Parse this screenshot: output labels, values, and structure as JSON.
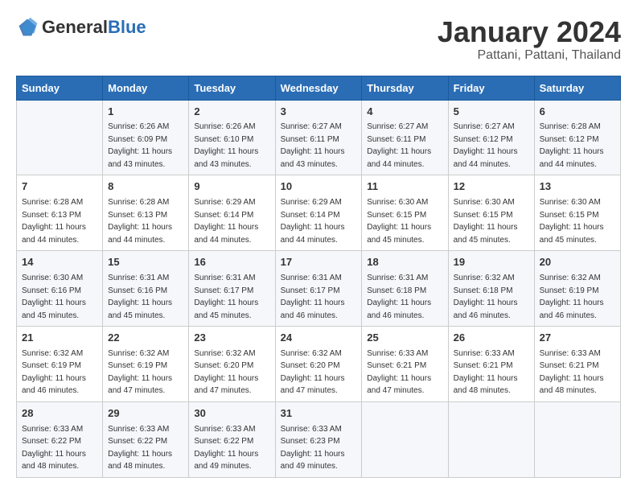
{
  "logo": {
    "general": "General",
    "blue": "Blue"
  },
  "title": "January 2024",
  "location": "Pattani, Pattani, Thailand",
  "days_of_week": [
    "Sunday",
    "Monday",
    "Tuesday",
    "Wednesday",
    "Thursday",
    "Friday",
    "Saturday"
  ],
  "weeks": [
    [
      {
        "num": "",
        "sunrise": "",
        "sunset": "",
        "daylight": ""
      },
      {
        "num": "1",
        "sunrise": "Sunrise: 6:26 AM",
        "sunset": "Sunset: 6:09 PM",
        "daylight": "Daylight: 11 hours and 43 minutes."
      },
      {
        "num": "2",
        "sunrise": "Sunrise: 6:26 AM",
        "sunset": "Sunset: 6:10 PM",
        "daylight": "Daylight: 11 hours and 43 minutes."
      },
      {
        "num": "3",
        "sunrise": "Sunrise: 6:27 AM",
        "sunset": "Sunset: 6:11 PM",
        "daylight": "Daylight: 11 hours and 43 minutes."
      },
      {
        "num": "4",
        "sunrise": "Sunrise: 6:27 AM",
        "sunset": "Sunset: 6:11 PM",
        "daylight": "Daylight: 11 hours and 44 minutes."
      },
      {
        "num": "5",
        "sunrise": "Sunrise: 6:27 AM",
        "sunset": "Sunset: 6:12 PM",
        "daylight": "Daylight: 11 hours and 44 minutes."
      },
      {
        "num": "6",
        "sunrise": "Sunrise: 6:28 AM",
        "sunset": "Sunset: 6:12 PM",
        "daylight": "Daylight: 11 hours and 44 minutes."
      }
    ],
    [
      {
        "num": "7",
        "sunrise": "Sunrise: 6:28 AM",
        "sunset": "Sunset: 6:13 PM",
        "daylight": "Daylight: 11 hours and 44 minutes."
      },
      {
        "num": "8",
        "sunrise": "Sunrise: 6:28 AM",
        "sunset": "Sunset: 6:13 PM",
        "daylight": "Daylight: 11 hours and 44 minutes."
      },
      {
        "num": "9",
        "sunrise": "Sunrise: 6:29 AM",
        "sunset": "Sunset: 6:14 PM",
        "daylight": "Daylight: 11 hours and 44 minutes."
      },
      {
        "num": "10",
        "sunrise": "Sunrise: 6:29 AM",
        "sunset": "Sunset: 6:14 PM",
        "daylight": "Daylight: 11 hours and 44 minutes."
      },
      {
        "num": "11",
        "sunrise": "Sunrise: 6:30 AM",
        "sunset": "Sunset: 6:15 PM",
        "daylight": "Daylight: 11 hours and 45 minutes."
      },
      {
        "num": "12",
        "sunrise": "Sunrise: 6:30 AM",
        "sunset": "Sunset: 6:15 PM",
        "daylight": "Daylight: 11 hours and 45 minutes."
      },
      {
        "num": "13",
        "sunrise": "Sunrise: 6:30 AM",
        "sunset": "Sunset: 6:15 PM",
        "daylight": "Daylight: 11 hours and 45 minutes."
      }
    ],
    [
      {
        "num": "14",
        "sunrise": "Sunrise: 6:30 AM",
        "sunset": "Sunset: 6:16 PM",
        "daylight": "Daylight: 11 hours and 45 minutes."
      },
      {
        "num": "15",
        "sunrise": "Sunrise: 6:31 AM",
        "sunset": "Sunset: 6:16 PM",
        "daylight": "Daylight: 11 hours and 45 minutes."
      },
      {
        "num": "16",
        "sunrise": "Sunrise: 6:31 AM",
        "sunset": "Sunset: 6:17 PM",
        "daylight": "Daylight: 11 hours and 45 minutes."
      },
      {
        "num": "17",
        "sunrise": "Sunrise: 6:31 AM",
        "sunset": "Sunset: 6:17 PM",
        "daylight": "Daylight: 11 hours and 46 minutes."
      },
      {
        "num": "18",
        "sunrise": "Sunrise: 6:31 AM",
        "sunset": "Sunset: 6:18 PM",
        "daylight": "Daylight: 11 hours and 46 minutes."
      },
      {
        "num": "19",
        "sunrise": "Sunrise: 6:32 AM",
        "sunset": "Sunset: 6:18 PM",
        "daylight": "Daylight: 11 hours and 46 minutes."
      },
      {
        "num": "20",
        "sunrise": "Sunrise: 6:32 AM",
        "sunset": "Sunset: 6:19 PM",
        "daylight": "Daylight: 11 hours and 46 minutes."
      }
    ],
    [
      {
        "num": "21",
        "sunrise": "Sunrise: 6:32 AM",
        "sunset": "Sunset: 6:19 PM",
        "daylight": "Daylight: 11 hours and 46 minutes."
      },
      {
        "num": "22",
        "sunrise": "Sunrise: 6:32 AM",
        "sunset": "Sunset: 6:19 PM",
        "daylight": "Daylight: 11 hours and 47 minutes."
      },
      {
        "num": "23",
        "sunrise": "Sunrise: 6:32 AM",
        "sunset": "Sunset: 6:20 PM",
        "daylight": "Daylight: 11 hours and 47 minutes."
      },
      {
        "num": "24",
        "sunrise": "Sunrise: 6:32 AM",
        "sunset": "Sunset: 6:20 PM",
        "daylight": "Daylight: 11 hours and 47 minutes."
      },
      {
        "num": "25",
        "sunrise": "Sunrise: 6:33 AM",
        "sunset": "Sunset: 6:21 PM",
        "daylight": "Daylight: 11 hours and 47 minutes."
      },
      {
        "num": "26",
        "sunrise": "Sunrise: 6:33 AM",
        "sunset": "Sunset: 6:21 PM",
        "daylight": "Daylight: 11 hours and 48 minutes."
      },
      {
        "num": "27",
        "sunrise": "Sunrise: 6:33 AM",
        "sunset": "Sunset: 6:21 PM",
        "daylight": "Daylight: 11 hours and 48 minutes."
      }
    ],
    [
      {
        "num": "28",
        "sunrise": "Sunrise: 6:33 AM",
        "sunset": "Sunset: 6:22 PM",
        "daylight": "Daylight: 11 hours and 48 minutes."
      },
      {
        "num": "29",
        "sunrise": "Sunrise: 6:33 AM",
        "sunset": "Sunset: 6:22 PM",
        "daylight": "Daylight: 11 hours and 48 minutes."
      },
      {
        "num": "30",
        "sunrise": "Sunrise: 6:33 AM",
        "sunset": "Sunset: 6:22 PM",
        "daylight": "Daylight: 11 hours and 49 minutes."
      },
      {
        "num": "31",
        "sunrise": "Sunrise: 6:33 AM",
        "sunset": "Sunset: 6:23 PM",
        "daylight": "Daylight: 11 hours and 49 minutes."
      },
      {
        "num": "",
        "sunrise": "",
        "sunset": "",
        "daylight": ""
      },
      {
        "num": "",
        "sunrise": "",
        "sunset": "",
        "daylight": ""
      },
      {
        "num": "",
        "sunrise": "",
        "sunset": "",
        "daylight": ""
      }
    ]
  ]
}
